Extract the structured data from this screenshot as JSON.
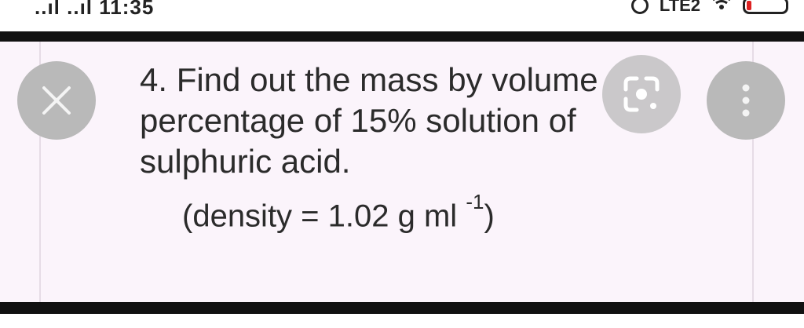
{
  "status_bar": {
    "left_text": "..ıl ..ıl 11:35",
    "network_label": "LTE2",
    "battery_label": "10"
  },
  "question": {
    "line1": "4. Find out the mass by volume",
    "line2": "percentage of 15% solution of",
    "line3": "sulphuric acid.",
    "density_prefix": "(density = 1.02 g ml",
    "density_exponent": "-1",
    "density_suffix": ")"
  },
  "icons": {
    "close": "close-icon",
    "lens": "google-lens-icon",
    "more": "more-vertical-icon",
    "sync": "sync-icon",
    "wifi": "wifi-icon",
    "battery": "battery-icon"
  },
  "colors": {
    "card_background": "#fbf4fb",
    "button_gray": "#b9b9b9",
    "divider": "#111111",
    "battery_low": "#dd2222"
  }
}
